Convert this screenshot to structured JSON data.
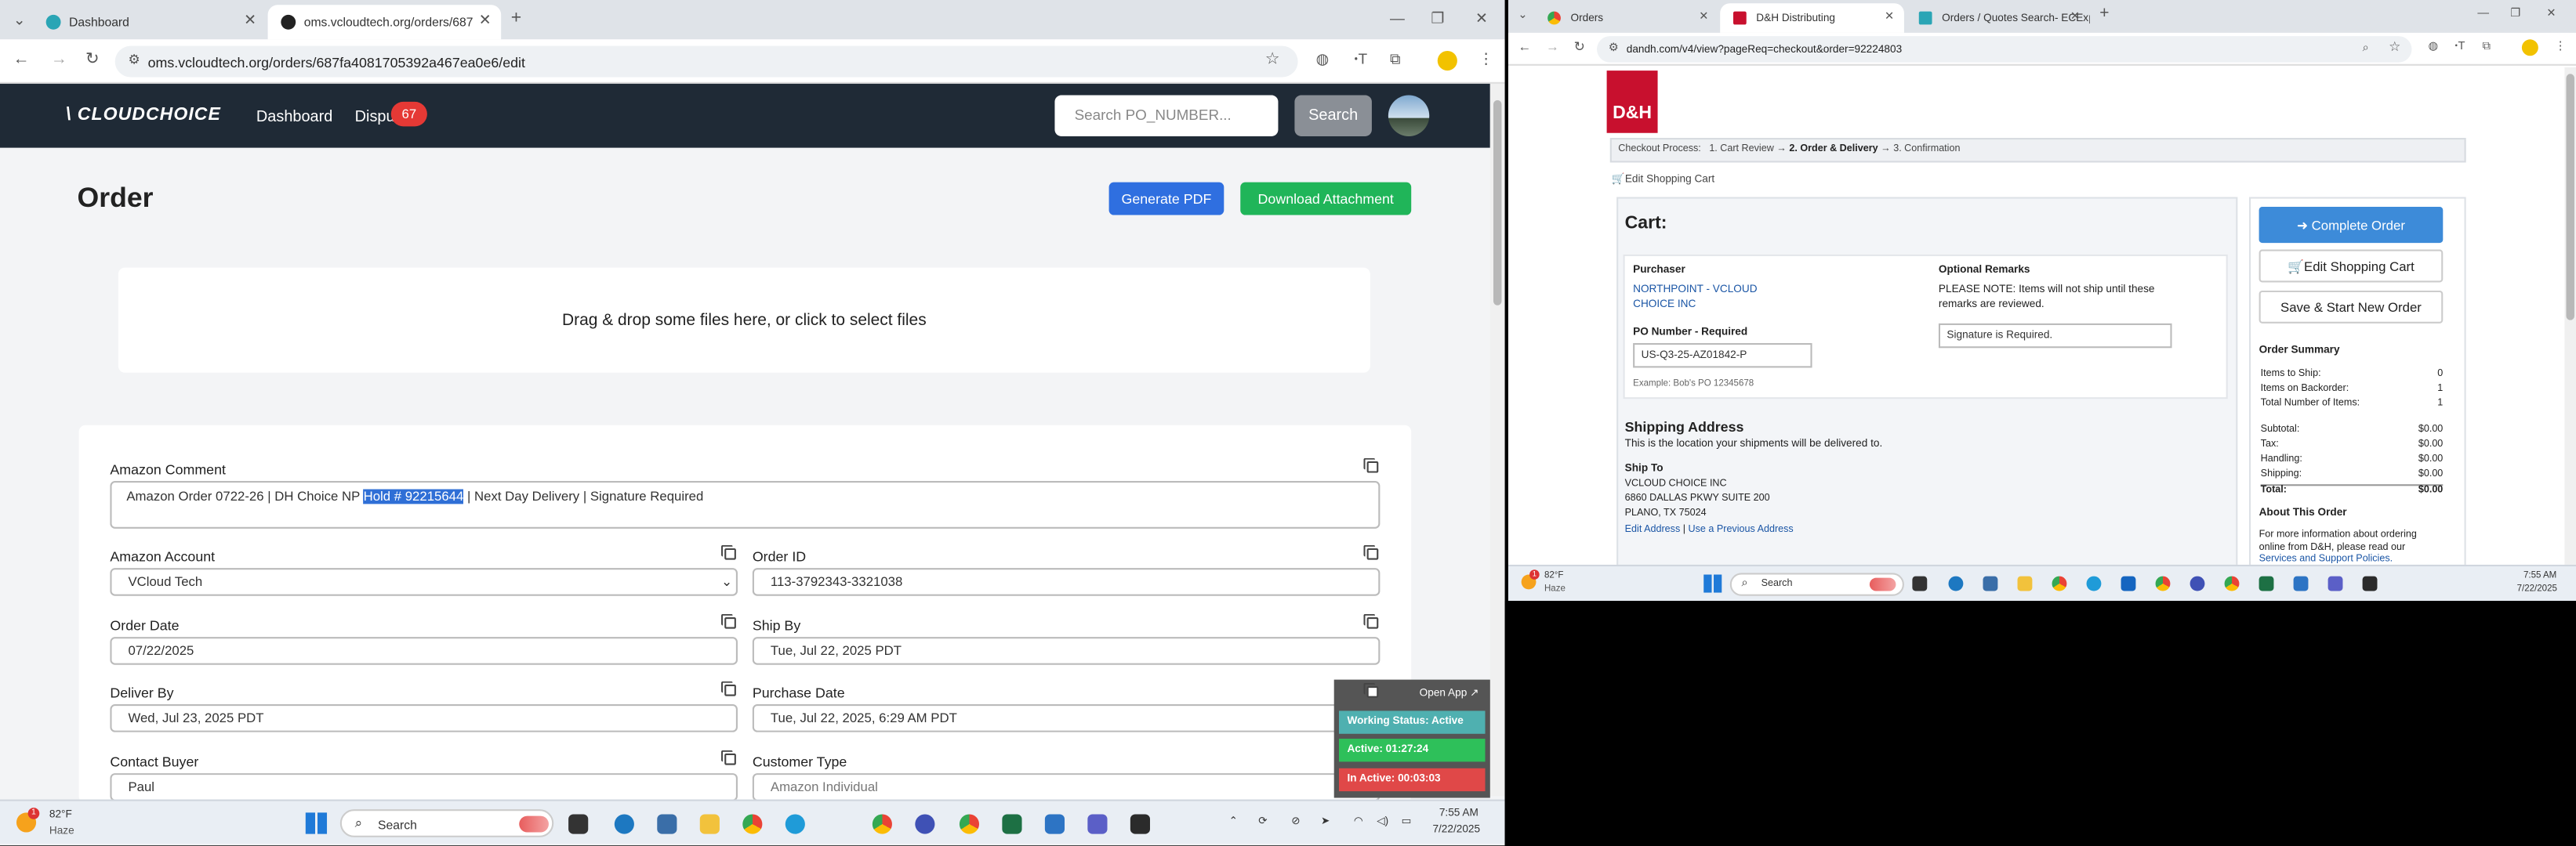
{
  "left_window": {
    "tabs": [
      {
        "label": "Dashboard",
        "active": false
      },
      {
        "label": "oms.vcloudtech.org/orders/687",
        "active": true
      }
    ],
    "url": "oms.vcloudtech.org/orders/687fa4081705392a467ea0e6/edit",
    "nav": {
      "logo": "CLOUDCHOICE",
      "dashboard": "Dashboard",
      "disputes": "Dispu",
      "disputes_badge": "67",
      "search_placeholder": "Search PO_NUMBER...",
      "search_button": "Search"
    },
    "page": {
      "title": "Order",
      "generate_pdf": "Generate PDF",
      "download_attachment": "Download Attachment",
      "dropzone": "Drag & drop some files here, or click to select files"
    },
    "form": {
      "amazon_comment_label": "Amazon Comment",
      "amazon_comment_before": "Amazon Order 0722-26 | DH Choice NP ",
      "amazon_comment_selected": "Hold # 92215644",
      "amazon_comment_after": " | Next Day Delivery | Signature Required",
      "amazon_account_label": "Amazon Account",
      "amazon_account_value": "VCloud Tech",
      "order_id_label": "Order ID",
      "order_id_value": "113-3792343-3321038",
      "order_date_label": "Order Date",
      "order_date_value": "07/22/2025",
      "ship_by_label": "Ship By",
      "ship_by_value": "Tue, Jul 22, 2025 PDT",
      "deliver_by_label": "Deliver By",
      "deliver_by_value": "Wed, Jul 23, 2025 PDT",
      "purchase_date_label": "Purchase Date",
      "purchase_date_value": "Tue, Jul 22, 2025, 6:29 AM PDT",
      "contact_buyer_label": "Contact Buyer",
      "contact_buyer_value": "Paul",
      "customer_type_label": "Customer Type",
      "customer_type_value": "Amazon Individual"
    },
    "widget": {
      "open_app": "Open App ↗",
      "working_status": "Working Status: Active",
      "active": "Active: 01:27:24",
      "inactive": "In Active: 00:03:03"
    },
    "taskbar": {
      "weather_temp": "82°F",
      "weather_desc": "Haze",
      "weather_badge": "1",
      "search": "Search",
      "time": "7:55 AM",
      "date": "7/22/2025"
    }
  },
  "right_window": {
    "tabs": [
      {
        "label": "Orders",
        "active": false
      },
      {
        "label": "D&H Distributing",
        "active": true
      },
      {
        "label": "Orders / Quotes Search- ECExp",
        "active": false
      }
    ],
    "url": "dandh.com/v4/view?pageReq=checkout&order=92224803",
    "logo": "D&H",
    "checkout_process_label": "Checkout Process:",
    "steps": [
      "1. Cart Review",
      "→",
      "2. Order & Delivery",
      "→",
      "3. Confirmation"
    ],
    "edit_cart_link": "Edit Shopping Cart",
    "cart_title": "Cart:",
    "purchaser_label": "Purchaser",
    "purchaser_name_1": "NORTHPOINT - VCLOUD",
    "purchaser_name_2": "CHOICE INC",
    "po_label": "PO Number - Required",
    "po_value": "US-Q3-25-AZ01842-P",
    "po_example": "Example: Bob's PO 12345678",
    "remarks_label": "Optional Remarks",
    "remarks_note_1": "PLEASE NOTE: Items will not ship until these",
    "remarks_note_2": "remarks are reviewed.",
    "remarks_value": "Signature is Required.",
    "shipping_title": "Shipping Address",
    "shipping_desc": "This is the location your shipments will be delivered to.",
    "ship_to_label": "Ship To",
    "ship_to_lines": [
      "VCLOUD CHOICE INC",
      "6860 DALLAS PKWY SUITE 200",
      "PLANO, TX 75024"
    ],
    "edit_address": "Edit Address",
    "separator": "|",
    "previous_address": "Use a Previous Address",
    "complete_order": "Complete Order",
    "edit_shopping_cart": "Edit Shopping Cart",
    "save_start_new": "Save & Start New Order",
    "summary_title": "Order Summary",
    "summary": [
      {
        "label": "Items to Ship:",
        "value": "0"
      },
      {
        "label": "Items on Backorder:",
        "value": "1"
      },
      {
        "label": "Total Number of Items:",
        "value": "1"
      }
    ],
    "totals": [
      {
        "label": "Subtotal:",
        "value": "$0.00"
      },
      {
        "label": "Tax:",
        "value": "$0.00"
      },
      {
        "label": "Handling:",
        "value": "$0.00"
      },
      {
        "label": "Shipping:",
        "value": "$0.00"
      },
      {
        "label": "Total:",
        "value": "$0.00"
      }
    ],
    "about_title": "About This Order",
    "about_text_1": "For more information about ordering",
    "about_text_2": "online from D&H, please read our",
    "about_link": "Services and Support Policies.",
    "taskbar": {
      "weather_temp": "82°F",
      "weather_desc": "Haze",
      "weather_badge": "1",
      "search": "Search",
      "time": "7:55 AM",
      "date": "7/22/2025"
    }
  },
  "colors": {
    "nav_dark": "#1f2a36",
    "primary_blue": "#2f6fe0",
    "green": "#20b559",
    "dh_red": "#c8102e",
    "dh_button_blue": "#3d8bd9",
    "widget_teal": "#4fb0b0",
    "widget_green": "#2ec05a",
    "widget_red": "#e04848"
  }
}
